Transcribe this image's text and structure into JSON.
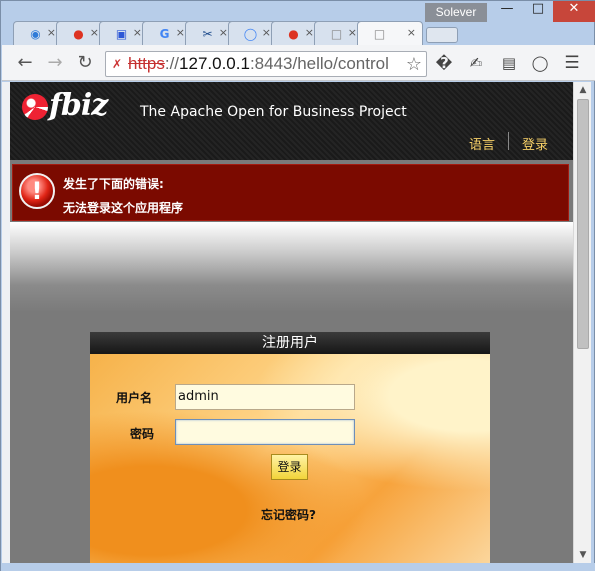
{
  "window": {
    "user_badge": "Solever",
    "min_icon": "minimize-icon",
    "max_icon": "maximize-icon",
    "close_icon": "close-icon"
  },
  "tabs": [
    {
      "icon": "chrome-icon"
    },
    {
      "icon": "ofbiz-icon"
    },
    {
      "icon": "baidu-paw-icon"
    },
    {
      "icon": "google-icon"
    },
    {
      "icon": "scissors-icon"
    },
    {
      "icon": "loading-spinner-icon"
    },
    {
      "icon": "ofbiz-icon"
    },
    {
      "icon": "blank-page-icon"
    },
    {
      "icon": "blank-page-icon",
      "active": true
    }
  ],
  "toolbar": {
    "url_scheme": "https",
    "url_sep": "://",
    "url_host": "127.0.0.1",
    "url_rest": ":8443/hello/control",
    "bookmark_icon": "star-icon",
    "extension_icons": [
      "unknown-glyph-icon",
      "eyedropper-icon",
      "reader-icon",
      "record-icon",
      "menu-icon"
    ]
  },
  "header": {
    "logo_text": "fbiz",
    "tagline": "The Apache Open for Business Project",
    "lang_link": "语言",
    "login_link": "登录"
  },
  "error": {
    "title": "发生了下面的错误:",
    "message": "无法登录这个应用程序"
  },
  "login": {
    "heading": "注册用户",
    "username_label": "用户名",
    "username_value": "admin",
    "password_label": "密码",
    "password_value": "",
    "submit_label": "登录",
    "forgot_link": "忘记密码?"
  },
  "colors": {
    "error_bg": "#7b0a00",
    "link_yellow": "#f7d067",
    "header_bg": "#1e1e1e"
  }
}
